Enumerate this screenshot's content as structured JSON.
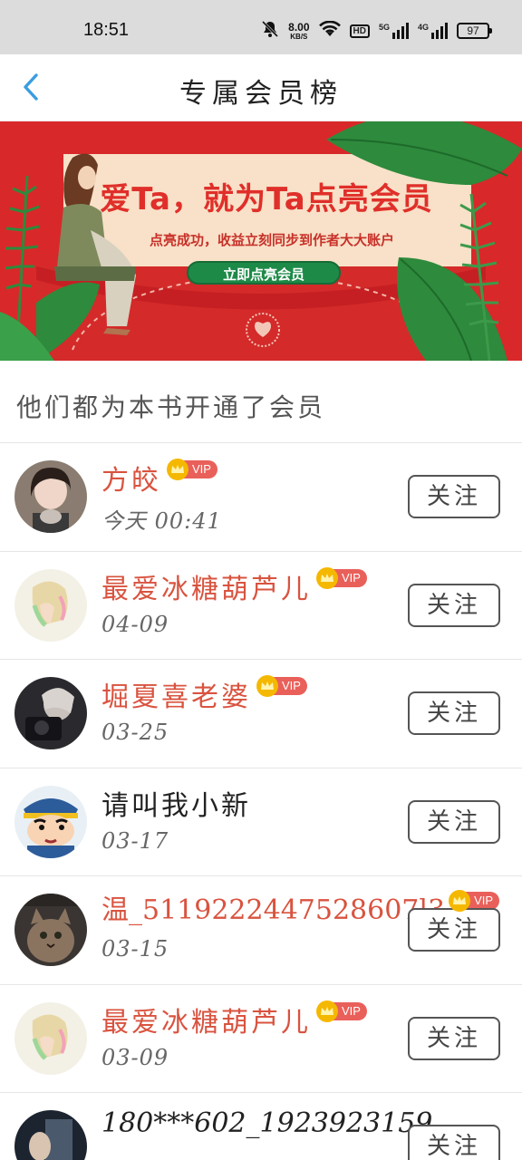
{
  "status_bar": {
    "time": "18:51",
    "net_speed_value": "8.00",
    "net_speed_unit": "KB/S",
    "hd_label": "HD",
    "sim1_label": "5G",
    "sim2_label": "4G",
    "battery": "97",
    "icons": [
      "mute-bell-icon",
      "wifi-icon",
      "hd-icon",
      "signal-5g-icon",
      "signal-4g-icon",
      "battery-icon"
    ]
  },
  "header": {
    "title": "专属会员榜",
    "back_icon": "chevron-left-icon"
  },
  "banner": {
    "headline": "爱Ta，就为Ta点亮会员",
    "subline": "点亮成功，收益立刻同步到作者大大账户",
    "cta": "立即点亮会员"
  },
  "section": {
    "title": "他们都为本书开通了会员"
  },
  "badge": {
    "vip_label": "VIP"
  },
  "colors": {
    "accent_red": "#d9533f",
    "banner_red": "#d9282a",
    "cta_green": "#1e8a48",
    "back_blue": "#3a9de0",
    "vip_gold": "#f5b800"
  },
  "members": [
    {
      "name": "方皎",
      "date": "今天 00:41",
      "vip": true,
      "follow_label": "关注"
    },
    {
      "name": "最爱冰糖葫芦儿",
      "date": "04-09",
      "vip": true,
      "follow_label": "关注"
    },
    {
      "name": "堀夏喜老婆",
      "date": "03-25",
      "vip": true,
      "follow_label": "关注"
    },
    {
      "name": "请叫我小新",
      "date": "03-17",
      "vip": false,
      "follow_label": "关注"
    },
    {
      "name": "温_5119222447528607l3",
      "date": "03-15",
      "vip": true,
      "follow_label": "关注"
    },
    {
      "name": "最爱冰糖葫芦儿",
      "date": "03-09",
      "vip": true,
      "follow_label": "关注"
    },
    {
      "name": "180***602_1923923159",
      "date": "",
      "vip": false,
      "follow_label": "关注"
    }
  ]
}
